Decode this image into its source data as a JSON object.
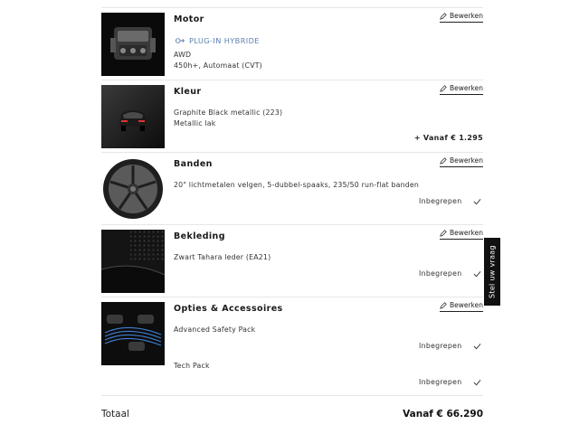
{
  "sections": [
    {
      "title": "Motor",
      "edit_label": "Bewerken",
      "badge": "PLUG-IN HYBRIDE",
      "lines": [
        "AWD",
        "450h+, Automaat (CVT)"
      ]
    },
    {
      "title": "Kleur",
      "edit_label": "Bewerken",
      "lines": [
        "Graphite Black metallic (223)",
        "Metallic lak"
      ],
      "price": "+ Vanaf € 1.295"
    },
    {
      "title": "Banden",
      "edit_label": "Bewerken",
      "lines": [
        "20\" lichtmetalen velgen, 5-dubbel-spaaks, 235/50 run-flat banden"
      ],
      "status": "Inbegrepen"
    },
    {
      "title": "Bekleding",
      "edit_label": "Bewerken",
      "lines": [
        "Zwart Tahara leder (EA21)"
      ],
      "status": "Inbegrepen"
    },
    {
      "title": "Opties & Accessoires",
      "edit_label": "Bewerken",
      "items": [
        {
          "label": "Advanced Safety Pack",
          "status": "Inbegrepen"
        },
        {
          "label": "Tech Pack",
          "status": "Inbegrepen"
        }
      ]
    }
  ],
  "total": {
    "label": "Totaal",
    "value": "Vanaf € 66.290"
  },
  "ask_tab": "Stel uw vraag",
  "colors": {
    "hybrid_accent": "#5a7fb0",
    "divider": "#e6e6e6",
    "tab_bg": "#111111"
  }
}
